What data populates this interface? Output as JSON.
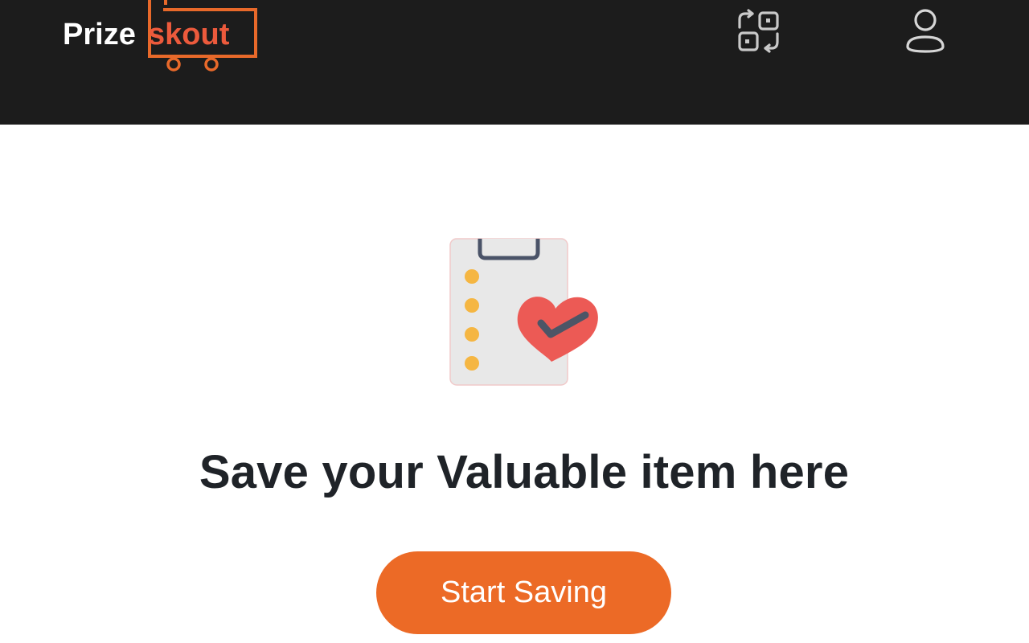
{
  "header": {
    "logo": {
      "text_part1": "Prize",
      "text_part2": "skout",
      "icon": "shopping-cart-logo"
    },
    "scan_button": {
      "icon": "scan-icon"
    },
    "profile_button": {
      "icon": "user-icon"
    }
  },
  "empty_state": {
    "illustration_icon": "clipboard-heart-icon",
    "title": "Save your Valuable item here",
    "cta_label": "Start Saving"
  },
  "colors": {
    "header_bg": "#1c1c1c",
    "accent": "#ec6a26",
    "logo_orange": "#e8692a",
    "title_text": "#1f2328",
    "heart": "#ec5a55",
    "dots": "#f5b642"
  }
}
